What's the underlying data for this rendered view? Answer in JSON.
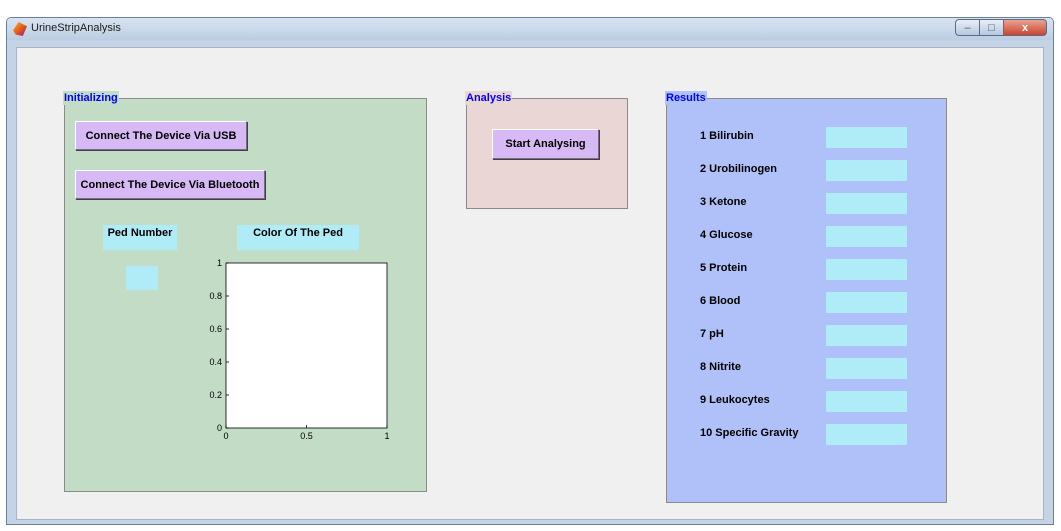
{
  "window": {
    "title": "UrineStripAnalysis",
    "controls": {
      "minimize": "–",
      "maximize": "□",
      "close": "x"
    }
  },
  "panels": {
    "initializing": {
      "title": "Initializing",
      "connect_usb_label": "Connect The Device Via USB",
      "connect_bluetooth_label": "Connect The Device Via Bluetooth",
      "ped_number_label": "Ped Number",
      "color_of_ped_label": "Color Of The Ped"
    },
    "analysis": {
      "title": "Analysis",
      "start_label": "Start Analysing"
    },
    "results": {
      "title": "Results",
      "items": [
        {
          "label": "1  Bilirubin",
          "value": ""
        },
        {
          "label": "2  Urobilinogen",
          "value": ""
        },
        {
          "label": "3  Ketone",
          "value": ""
        },
        {
          "label": "4  Glucose",
          "value": ""
        },
        {
          "label": "5  Protein",
          "value": ""
        },
        {
          "label": "6  Blood",
          "value": ""
        },
        {
          "label": "7  pH",
          "value": ""
        },
        {
          "label": "8  Nitrite",
          "value": ""
        },
        {
          "label": "9  Leukocytes",
          "value": ""
        },
        {
          "label": "10 Specific Gravity",
          "value": ""
        }
      ]
    }
  },
  "colors": {
    "initializing_bg": "#c2dcc5",
    "analysis_bg": "#ebd6d6",
    "results_bg": "#b0c0f8",
    "button_bg": "#d7b9f5",
    "field_bg": "#b0ecf8",
    "panel_title": "#0000ff"
  },
  "chart_data": {
    "type": "scatter",
    "title": "",
    "xlabel": "",
    "ylabel": "",
    "xlim": [
      0,
      1
    ],
    "ylim": [
      0,
      1
    ],
    "x_ticks": [
      "0",
      "0.5",
      "1"
    ],
    "y_ticks": [
      "0",
      "0.2",
      "0.4",
      "0.6",
      "0.8",
      "1"
    ],
    "series": [],
    "grid": false
  }
}
